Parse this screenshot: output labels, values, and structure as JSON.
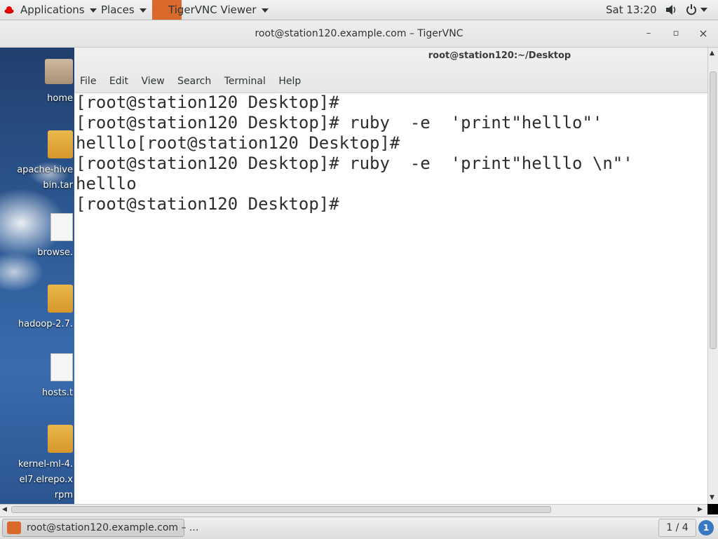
{
  "topbar": {
    "applications": "Applications",
    "places": "Places",
    "active_app": "TigerVNC Viewer",
    "clock": "Sat 13:20",
    "icons": [
      "red-hat-icon",
      "tigervnc-icon",
      "volume-icon",
      "power-icon",
      "chevron-down-icon"
    ]
  },
  "vnc_window": {
    "title": "root@station120.example.com – TigerVNC",
    "controls": {
      "minimize": "–",
      "maximize": "▫",
      "close": "×"
    }
  },
  "desktop": {
    "icons": [
      {
        "label": "home",
        "icon": "home-folder-icon"
      },
      {
        "label": "apache-hive",
        "label2": "bin.tar",
        "icon": "archive-icon"
      },
      {
        "label": "browse.",
        "icon": "text-file-icon"
      },
      {
        "label": "hadoop-2.7.",
        "icon": "archive-icon"
      },
      {
        "label": "hosts.t",
        "icon": "text-file-icon"
      },
      {
        "label": "kernel-ml-4.",
        "label2": "el7.elrepo.x",
        "label3": "rpm",
        "icon": "archive-icon"
      }
    ]
  },
  "terminal": {
    "title": "root@station120:~/Desktop",
    "menu": [
      "File",
      "Edit",
      "View",
      "Search",
      "Terminal",
      "Help"
    ],
    "lines": [
      "[root@station120 Desktop]#",
      "[root@station120 Desktop]# ruby  -e  'print\"helllo\"'",
      "helllo[root@station120 Desktop]#",
      "[root@station120 Desktop]# ruby  -e  'print\"helllo \\n\"'",
      "helllo",
      "[root@station120 Desktop]# "
    ]
  },
  "taskbar": {
    "window_button": "root@station120.example.com – ...",
    "workspace": "1 / 4",
    "notifications": "1"
  }
}
